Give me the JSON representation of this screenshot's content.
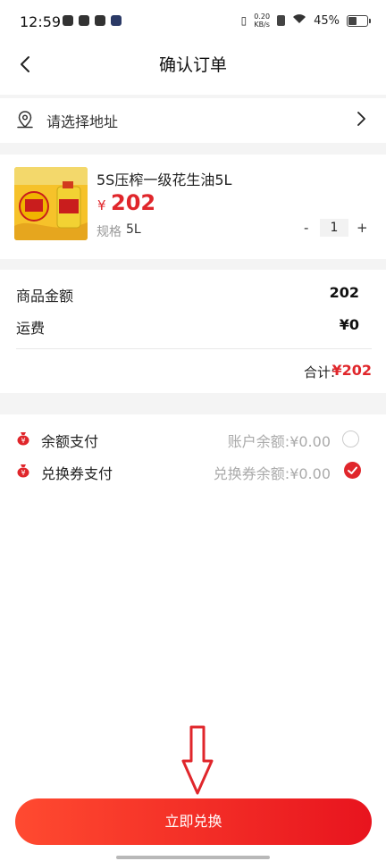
{
  "status_bar": {
    "time": "12:59",
    "net_speed_top": "0.20",
    "net_speed_unit": "KB/s",
    "battery": "45%"
  },
  "header": {
    "title": "确认订单"
  },
  "address": {
    "placeholder": "请选择地址"
  },
  "product": {
    "name": "5S压榨一级花生油5L",
    "currency": "¥",
    "price": "202",
    "spec_label": "规格",
    "spec_value": "5L",
    "qty_minus": "-",
    "qty": "1",
    "qty_plus": "+"
  },
  "amounts": {
    "goods_label": "商品金额",
    "goods_value": "202",
    "shipping_label": "运费",
    "shipping_value": "¥0",
    "total_label": "合计:",
    "total_value": "¥202"
  },
  "payment": {
    "balance_label": "余额支付",
    "balance_info": "账户余额:¥0.00",
    "balance_selected": false,
    "voucher_label": "兑换券支付",
    "voucher_info": "兑换券余额:¥0.00",
    "voucher_selected": true
  },
  "cta": {
    "label": "立即兑换"
  },
  "colors": {
    "accent": "#e0262b",
    "cta_start": "#ff4a30",
    "cta_end": "#e8141e",
    "band": "#f4f4f4"
  }
}
